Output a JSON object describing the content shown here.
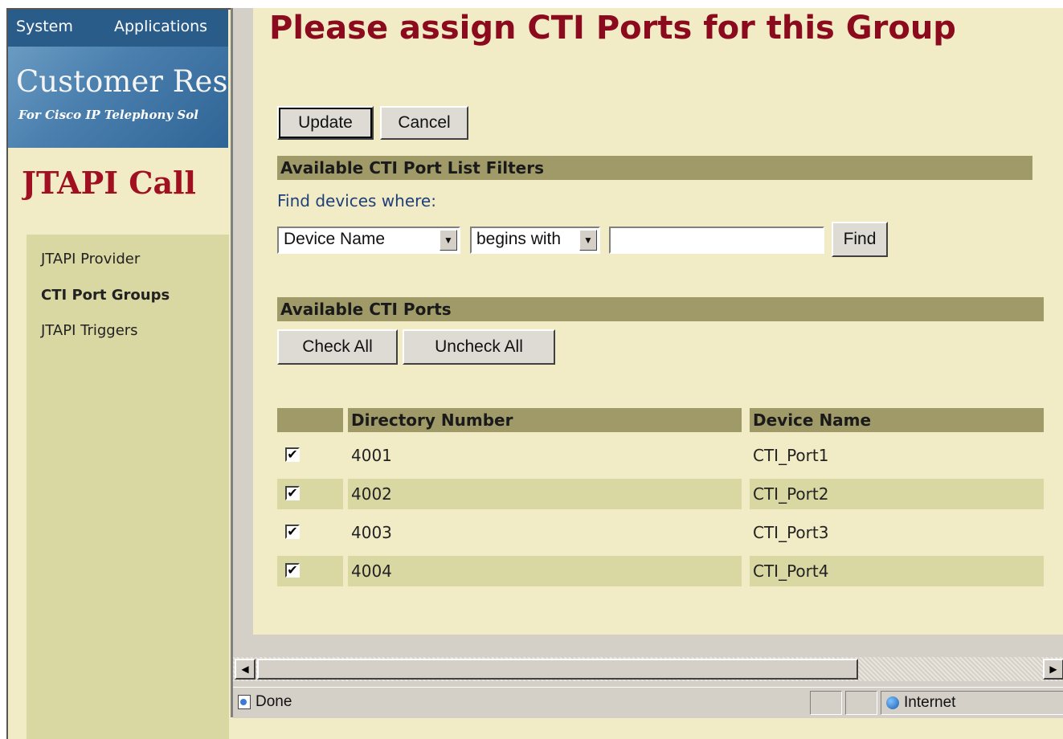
{
  "left_panel": {
    "nav": {
      "system": "System",
      "applications": "Applications"
    },
    "banner": {
      "title": "Customer Res",
      "subtitle": "For Cisco IP Telephony Sol"
    },
    "page_title": "JTAPI Call",
    "sidebar_items": [
      {
        "label": "JTAPI Provider"
      },
      {
        "label": "CTI Port Groups",
        "active": true
      },
      {
        "label": "JTAPI Triggers"
      }
    ]
  },
  "main": {
    "heading": "Please assign CTI Ports for this Group",
    "buttons": {
      "update": "Update",
      "cancel": "Cancel",
      "find": "Find",
      "check_all": "Check All",
      "uncheck_all": "Uncheck All"
    },
    "filters": {
      "title": "Available CTI Port List Filters",
      "find_label": "Find devices where:",
      "field_select": "Device Name",
      "operator_select": "begins with",
      "search_value": ""
    },
    "ports": {
      "title": "Available CTI Ports",
      "columns": [
        "",
        "Directory Number",
        "Device Name"
      ],
      "rows": [
        {
          "checked": true,
          "directory_number": "4001",
          "device_name": "CTI_Port1"
        },
        {
          "checked": true,
          "directory_number": "4002",
          "device_name": "CTI_Port2"
        },
        {
          "checked": true,
          "directory_number": "4003",
          "device_name": "CTI_Port3"
        },
        {
          "checked": true,
          "directory_number": "4004",
          "device_name": "CTI_Port4"
        }
      ]
    }
  },
  "statusbar": {
    "status": "Done",
    "zone": "Internet"
  },
  "colors": {
    "heading": "#8b0a1e",
    "section_bar": "#a09a68",
    "background": "#f1ecc6",
    "row_shade": "#d9d7a2"
  }
}
